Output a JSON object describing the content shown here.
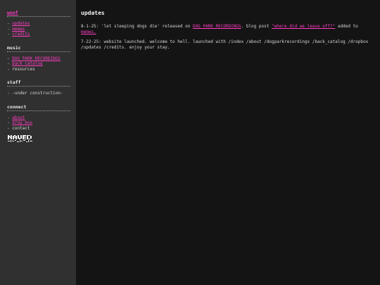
{
  "sidebar": {
    "home": {
      "title": "woof",
      "items": [
        "updates",
        "memes",
        "credits"
      ]
    },
    "music": {
      "title": "music",
      "items": [
        {
          "label": "DOG PARK RECORDINGS",
          "link": true
        },
        {
          "label": "back catalog",
          "link": true
        },
        {
          "label": "resources",
          "link": false
        }
      ]
    },
    "staff": {
      "title": "staff",
      "items": [
        "-under construction-"
      ]
    },
    "connect": {
      "title": "connect",
      "items": [
        {
          "label": "about",
          "link": true
        },
        {
          "label": "drop box",
          "link": true
        },
        {
          "label": "contact",
          "link": false
        }
      ]
    },
    "dash": "- "
  },
  "main": {
    "title": "updates",
    "entry1": {
      "prefix": "8-1-25: 'let sleeping dogs die' released on ",
      "label_link": "DOG PARK RECORDINGS",
      "mid": ". blog post ",
      "post_link": "\"where did we leave off?\"",
      "mid2": " added to ",
      "memes_link": "memes."
    },
    "entry2": "7-22-25: website launched. welcome to hell. launched with /index /about /dogparkrecordings /back_catalog /dropbox /updates /credits. enjoy your stay."
  },
  "colors": {
    "accent": "#ff3dc1",
    "sidebar_bg": "#303030",
    "main_bg": "#141414"
  }
}
